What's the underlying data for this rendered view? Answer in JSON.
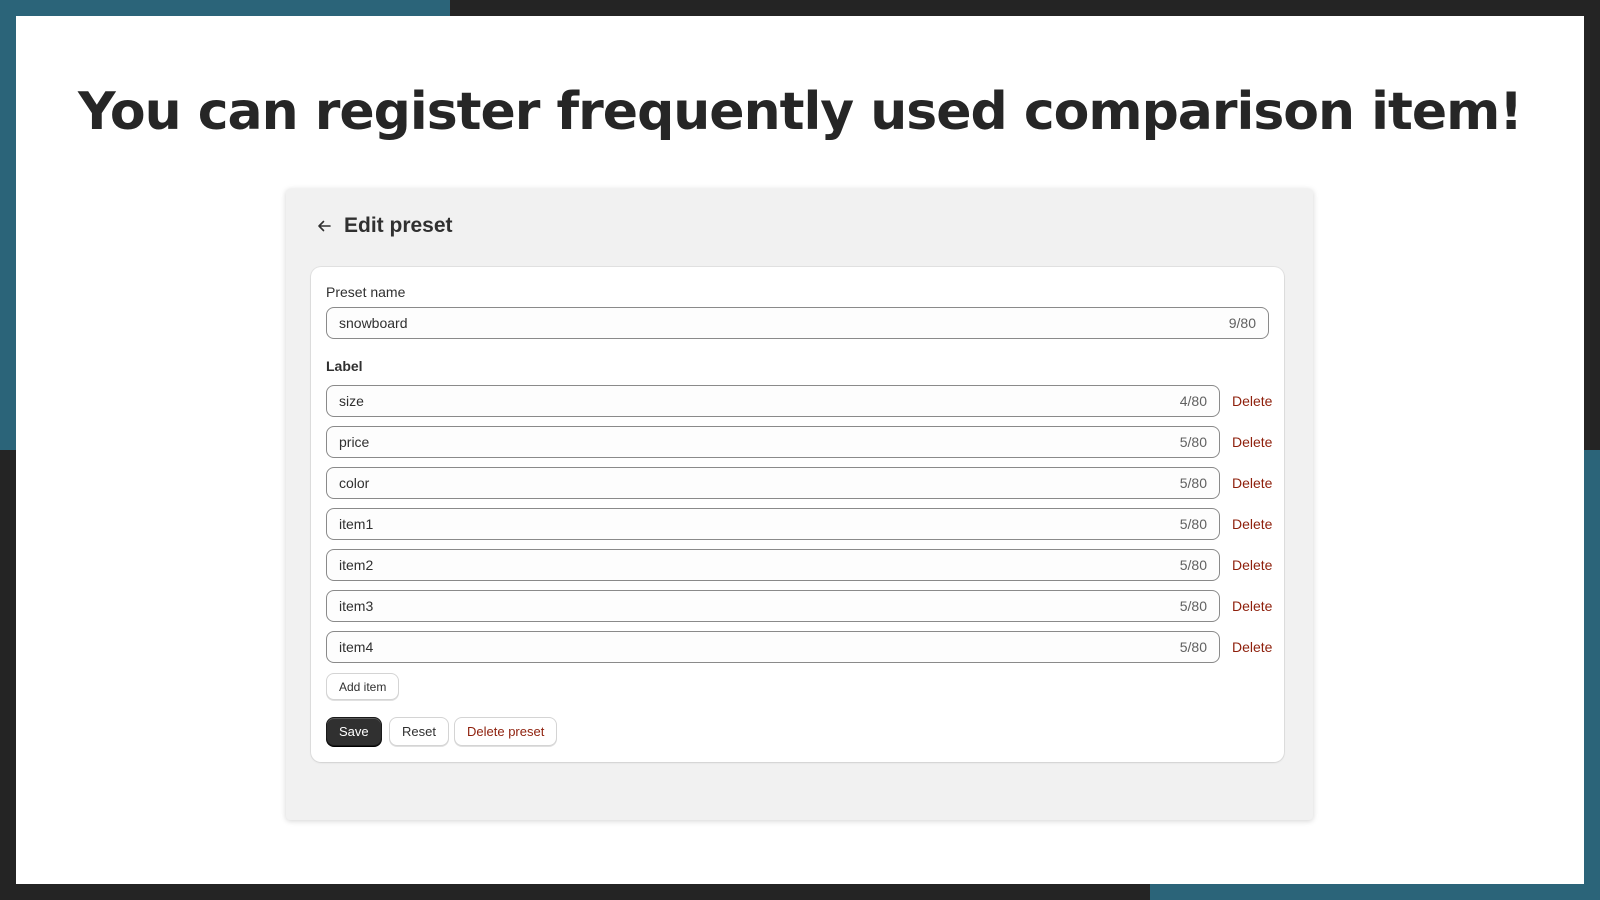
{
  "colors": {
    "accent_teal": "#2b6479",
    "frame_dark": "#242424",
    "critical_text": "#8e1f0b",
    "primary_button": "#303030"
  },
  "headline": "You can register frequently used comparison item!",
  "panel": {
    "back_icon": "arrow-left-icon",
    "title": "Edit preset"
  },
  "form": {
    "preset_name_label": "Preset name",
    "preset_name": {
      "value": "snowboard",
      "count": "9/80"
    },
    "label_heading": "Label",
    "delete_label": "Delete",
    "labels": [
      {
        "value": "size",
        "count": "4/80"
      },
      {
        "value": "price",
        "count": "5/80"
      },
      {
        "value": "color",
        "count": "5/80"
      },
      {
        "value": "item1",
        "count": "5/80"
      },
      {
        "value": "item2",
        "count": "5/80"
      },
      {
        "value": "item3",
        "count": "5/80"
      },
      {
        "value": "item4",
        "count": "5/80"
      }
    ],
    "add_item_label": "Add item"
  },
  "actions": {
    "save": "Save",
    "reset": "Reset",
    "delete_preset": "Delete preset"
  }
}
